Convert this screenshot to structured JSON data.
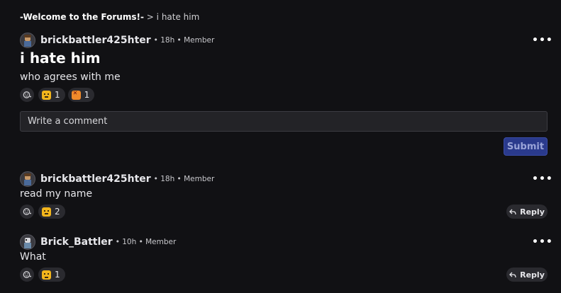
{
  "breadcrumb": {
    "root": "-Welcome to the Forums!-",
    "separator": ">",
    "current": "i hate him"
  },
  "post": {
    "author": "brickbattler425hter",
    "meta": "• 18h • Member",
    "more": "•••",
    "title": "i hate him",
    "body": "who agrees with me",
    "reactions": [
      {
        "emoji": "thinking-emoji",
        "count": "1"
      },
      {
        "emoji": "angry-emoji",
        "count": "1"
      }
    ]
  },
  "comment_input": {
    "placeholder": "Write a comment"
  },
  "submit": {
    "label": "Submit"
  },
  "comments": [
    {
      "author": "brickbattler425hter",
      "meta": "• 18h • Member",
      "more": "•••",
      "text": "read my name",
      "reactions": [
        {
          "emoji": "thinking-emoji",
          "count": "2"
        }
      ],
      "reply_label": "Reply"
    },
    {
      "author": "Brick_Battler",
      "meta": "• 10h • Member",
      "more": "•••",
      "text": "What",
      "reactions": [
        {
          "emoji": "sad-emoji",
          "count": "1"
        }
      ],
      "reply_label": "Reply"
    }
  ],
  "colors": {
    "background": "#111114",
    "submit_bg": "#2a3a8c",
    "pill_bg": "#2a2a2f"
  }
}
